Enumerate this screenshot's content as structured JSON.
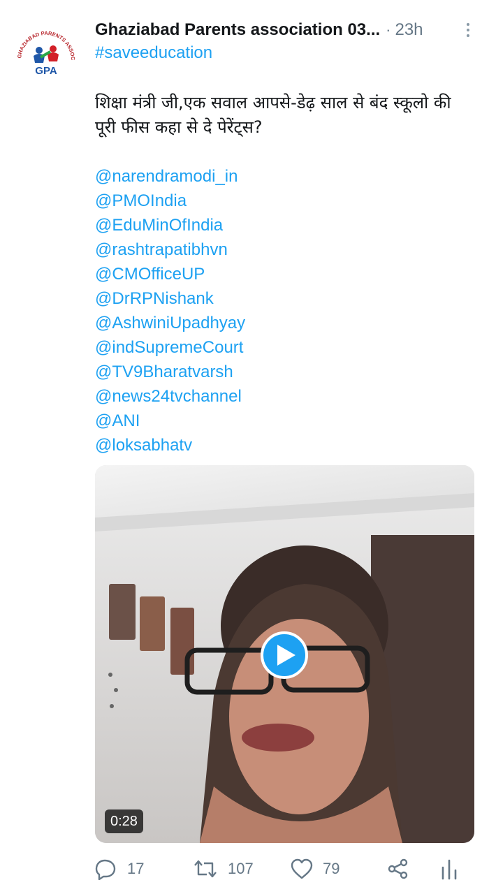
{
  "author": {
    "name": "Ghaziabad Parents association 03...",
    "separator": "·",
    "time": "23h",
    "avatar": {
      "logo_text": "GPA",
      "ring_text": "GHAZIABAD PARENTS ASSOCIATION"
    }
  },
  "tweet": {
    "hashtag": "#saveeducation",
    "text": "शिक्षा मंत्री जी,एक सवाल आपसे-डेढ़ साल से बंद स्कूलो की पूरी फीस कहा से दे पेरेंट्स?",
    "mentions": [
      "@narendramodi_in",
      "@PMOIndia",
      "@EduMinOfIndia",
      "@rashtrapatibhvn",
      "@CMOfficeUP",
      "@DrRPNishank",
      "@AshwiniUpadhyay",
      "@indSupremeCourt",
      "@TV9Bharatvarsh",
      "@news24tvchannel",
      "@ANI",
      "@loksabhatv"
    ]
  },
  "video": {
    "duration": "0:28"
  },
  "actions": {
    "replies": "17",
    "retweets": "107",
    "likes": "79"
  },
  "colors": {
    "accent": "#1da1f2",
    "text": "#14171a",
    "muted": "#657786"
  }
}
